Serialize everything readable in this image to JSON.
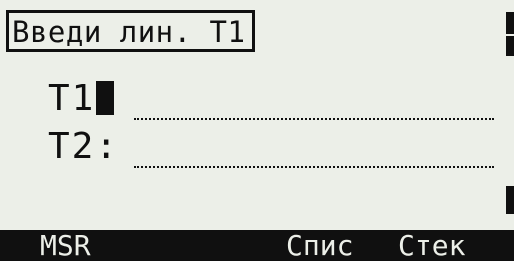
{
  "title": "Введи лин. T1",
  "fields": [
    {
      "label": "T1:",
      "value": ""
    },
    {
      "label": "T2:",
      "value": ""
    }
  ],
  "softkeys": [
    {
      "label": "MSR"
    },
    {
      "label": "Спис"
    },
    {
      "label": "Стек"
    }
  ],
  "colors": {
    "screen_background": "#ecefe8",
    "ink": "#101010"
  }
}
